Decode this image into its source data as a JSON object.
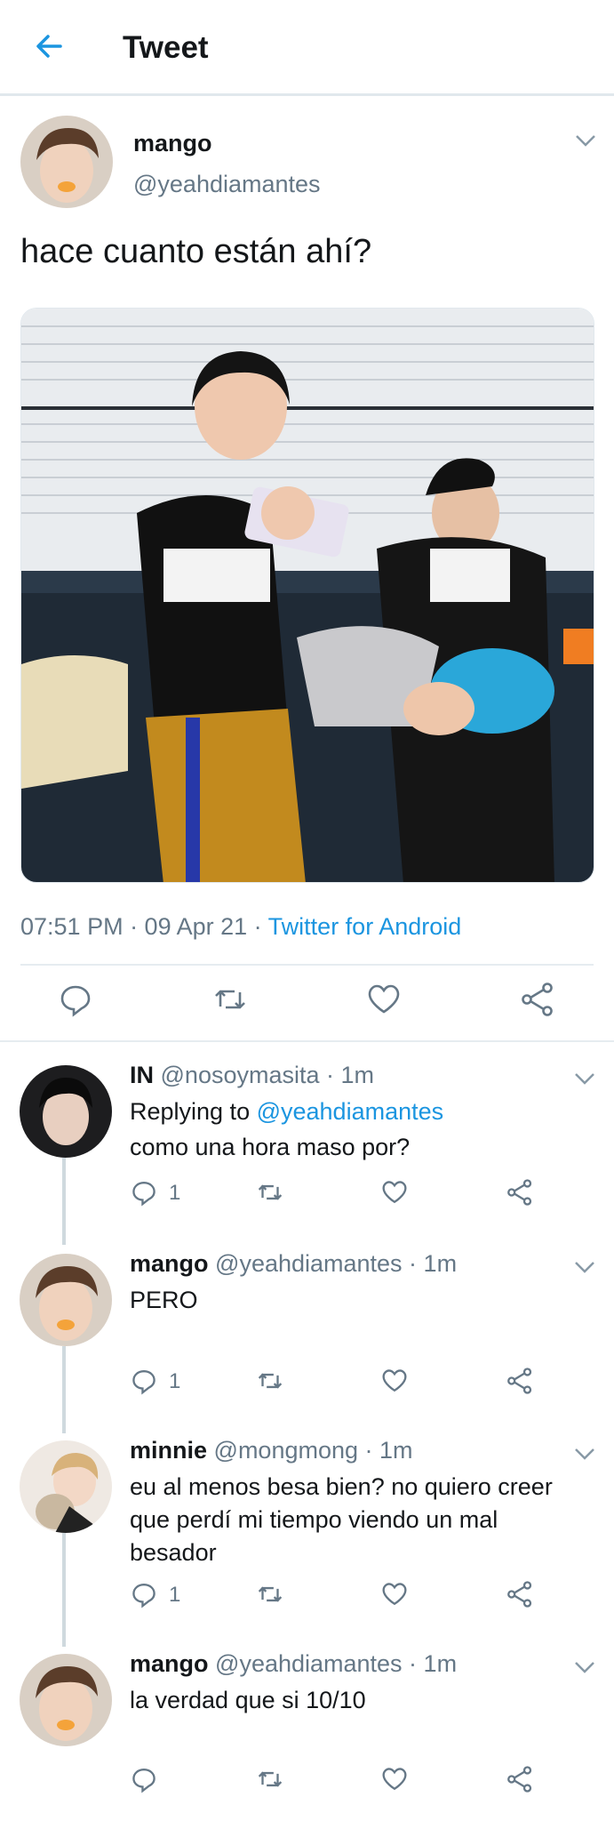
{
  "header": {
    "title": "Tweet",
    "back_icon": "arrow-left-icon",
    "accent": "#1b95e0"
  },
  "tweet": {
    "name": "mango",
    "handle": "@yeahdiamantes",
    "text": "hace cuanto están ahí?",
    "time": "07:51 PM · 09 Apr 21 · ",
    "source": "Twitter for Android",
    "actions": [
      "reply-icon",
      "retweet-icon",
      "like-icon",
      "share-icon"
    ]
  },
  "replies": [
    {
      "name": "IN",
      "handle": "@nosoymasita · 1m",
      "replying_prefix": "Replying to ",
      "replying_to": "@yeahdiamantes",
      "text": "como una hora maso por?",
      "reply_count": "1"
    },
    {
      "name": "mango",
      "handle": "@yeahdiamantes · 1m",
      "text": "PERO",
      "reply_count": "1"
    },
    {
      "name": "minnie",
      "handle": "@mongmong · 1m",
      "text_lines": [
        "eu al menos besa bien? no quiero creer",
        "que perdí mi tiempo viendo un mal",
        "besador"
      ],
      "reply_count": "1"
    },
    {
      "name": "mango",
      "handle": "@yeahdiamantes · 1m",
      "text": "la verdad que si 10/10",
      "reply_count": ""
    }
  ]
}
